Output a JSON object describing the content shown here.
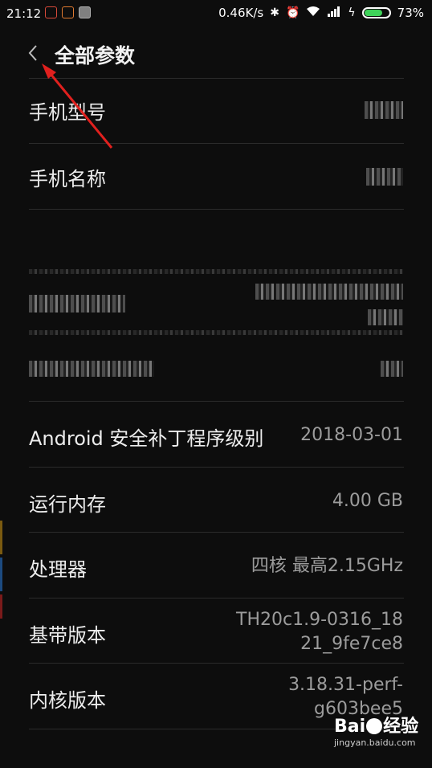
{
  "status_bar": {
    "time": "21:12",
    "network_speed": "0.46K/s",
    "battery_percent": "73%",
    "battery_level": 0.73,
    "icons": [
      "bluetooth-icon",
      "alarm-icon",
      "wifi-icon",
      "signal-icon",
      "charging-icon"
    ]
  },
  "header": {
    "title": "全部参数",
    "back_icon": "chevron-left-icon"
  },
  "rows": [
    {
      "label": "手机型号",
      "value": ""
    },
    {
      "label": "手机名称",
      "value": ""
    },
    {
      "label": "Android 安全补丁程序级别",
      "value": "2018-03-01"
    },
    {
      "label": "运行内存",
      "value": "4.00 GB"
    },
    {
      "label": "处理器",
      "value": "四核 最高2.15GHz"
    },
    {
      "label": "基带版本",
      "value_line1": "TH20c1.9-0316_18",
      "value_line2": "21_9fe7ce8"
    },
    {
      "label": "内核版本",
      "value_line1": "3.18.31-perf-",
      "value_line2": "g603bee5"
    }
  ],
  "watermark": {
    "logo_text_1": "Bai",
    "logo_text_2": "经验",
    "url": "jingyan.baidu.com"
  },
  "colors": {
    "background": "#0d0d0d",
    "annotation_arrow": "#e0201e",
    "battery_fill": "#3fd35a"
  }
}
